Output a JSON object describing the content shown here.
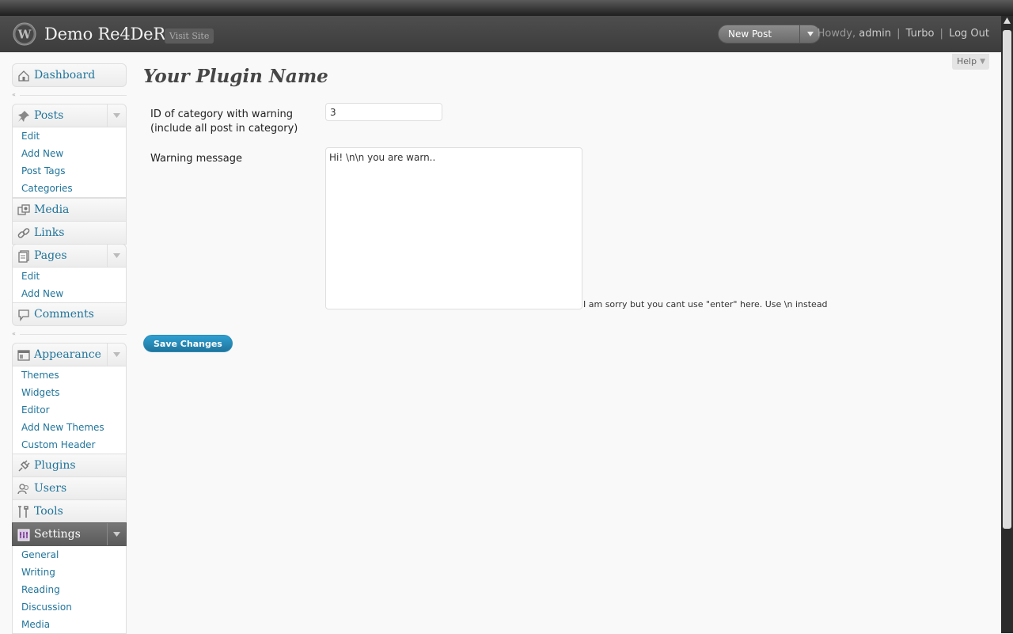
{
  "header": {
    "site_title": "Demo Re4DeR",
    "visit_site": "Visit Site",
    "favorite_action": "New Post",
    "howdy": "Howdy,",
    "username": "admin",
    "turbo": "Turbo",
    "logout": "Log Out",
    "separator": "|"
  },
  "help": {
    "label": "Help",
    "arrow": "▼"
  },
  "menu": {
    "dashboard": "Dashboard",
    "posts": {
      "label": "Posts",
      "items": [
        "Edit",
        "Add New",
        "Post Tags",
        "Categories"
      ]
    },
    "media": "Media",
    "links": "Links",
    "pages": {
      "label": "Pages",
      "items": [
        "Edit",
        "Add New"
      ]
    },
    "comments": "Comments",
    "appearance": {
      "label": "Appearance",
      "items": [
        "Themes",
        "Widgets",
        "Editor",
        "Add New Themes",
        "Custom Header"
      ]
    },
    "plugins": "Plugins",
    "users": "Users",
    "tools": "Tools",
    "settings": {
      "label": "Settings",
      "items": [
        "General",
        "Writing",
        "Reading",
        "Discussion",
        "Media"
      ]
    },
    "collapse_arrow": "«"
  },
  "main": {
    "title": "Your Plugin Name",
    "category_label": "ID of category with warning (include all post in category)",
    "category_value": "3",
    "message_label": "Warning message",
    "message_value": "Hi! \\n\\n you are warn..",
    "message_hint": "I am sorry but you cant use \"enter\" here. Use \\n instead",
    "save_label": "Save Changes"
  },
  "colors": {
    "link": "#21759b",
    "header_bg": "#464646",
    "button": "#21759b"
  }
}
